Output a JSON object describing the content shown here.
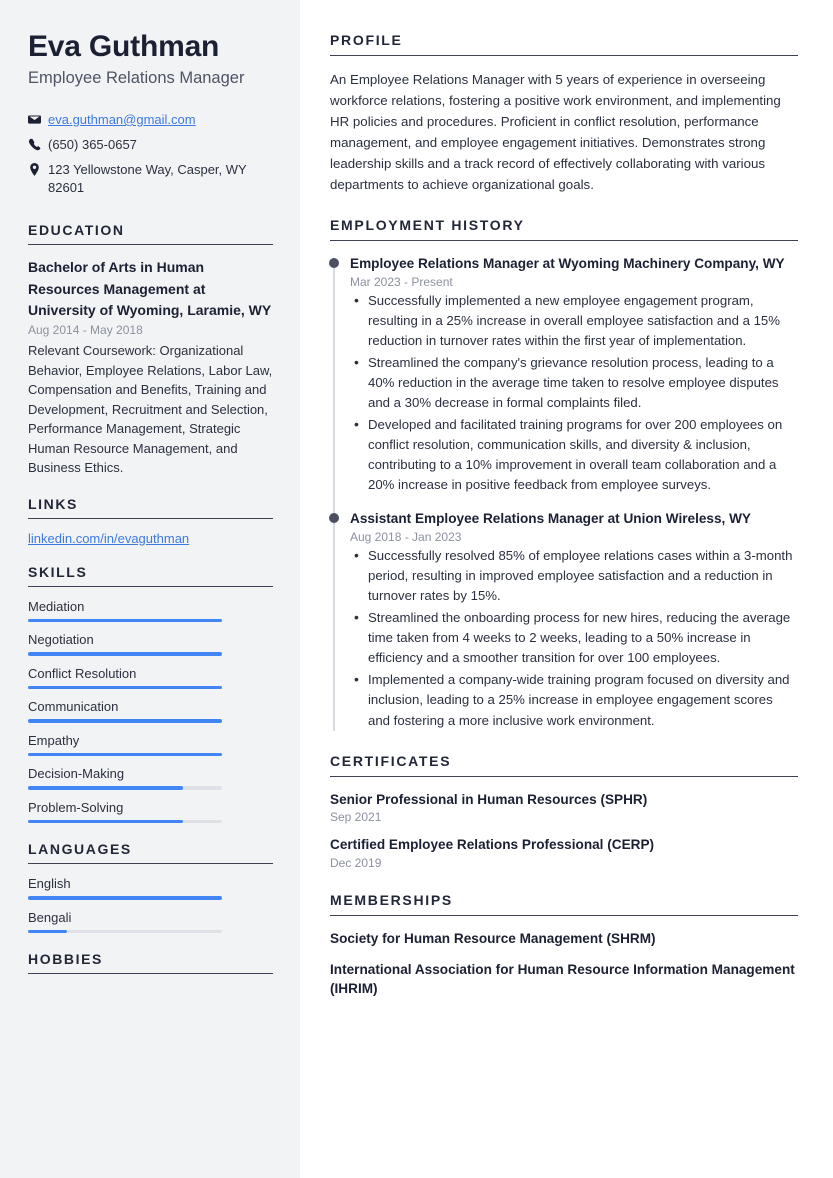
{
  "colors": {
    "accent": "#4285f4",
    "link": "#3d7ae0",
    "heading": "#222738",
    "sidebar_bg": "#f2f3f5",
    "muted": "#8c91a0",
    "dot": "#4a4f63"
  },
  "sidebar": {
    "name": "Eva Guthman",
    "job_title": "Employee Relations Manager",
    "contact": {
      "email": "eva.guthman@gmail.com",
      "phone": "(650) 365-0657",
      "address": "123 Yellowstone Way, Casper, WY 82601"
    },
    "education": {
      "heading": "EDUCATION",
      "items": [
        {
          "title": "Bachelor of Arts in Human Resources Management at University of Wyoming, Laramie, WY",
          "date": "Aug 2014 - May 2018",
          "description": "Relevant Coursework: Organizational Behavior, Employee Relations, Labor Law, Compensation and Benefits, Training and Development, Recruitment and Selection, Performance Management, Strategic Human Resource Management, and Business Ethics."
        }
      ]
    },
    "links": {
      "heading": "LINKS",
      "items": [
        {
          "label": "linkedin.com/in/evaguthman"
        }
      ]
    },
    "skills": {
      "heading": "SKILLS",
      "items": [
        {
          "label": "Mediation",
          "level": 100
        },
        {
          "label": "Negotiation",
          "level": 100
        },
        {
          "label": "Conflict Resolution",
          "level": 100
        },
        {
          "label": "Communication",
          "level": 100
        },
        {
          "label": "Empathy",
          "level": 100
        },
        {
          "label": "Decision-Making",
          "level": 80
        },
        {
          "label": "Problem-Solving",
          "level": 80
        }
      ]
    },
    "languages": {
      "heading": "LANGUAGES",
      "items": [
        {
          "label": "English",
          "level": 100
        },
        {
          "label": "Bengali",
          "level": 20
        }
      ]
    },
    "hobbies": {
      "heading": "HOBBIES"
    }
  },
  "main": {
    "profile": {
      "heading": "PROFILE",
      "text": "An Employee Relations Manager with 5 years of experience in overseeing workforce relations, fostering a positive work environment, and implementing HR policies and procedures. Proficient in conflict resolution, performance management, and employee engagement initiatives. Demonstrates strong leadership skills and a track record of effectively collaborating with various departments to achieve organizational goals."
    },
    "employment": {
      "heading": "EMPLOYMENT HISTORY",
      "jobs": [
        {
          "role": "Employee Relations Manager at Wyoming Machinery Company, WY",
          "date": "Mar 2023 - Present",
          "bullets": [
            "Successfully implemented a new employee engagement program, resulting in a 25% increase in overall employee satisfaction and a 15% reduction in turnover rates within the first year of implementation.",
            "Streamlined the company's grievance resolution process, leading to a 40% reduction in the average time taken to resolve employee disputes and a 30% decrease in formal complaints filed.",
            "Developed and facilitated training programs for over 200 employees on conflict resolution, communication skills, and diversity & inclusion, contributing to a 10% improvement in overall team collaboration and a 20% increase in positive feedback from employee surveys."
          ]
        },
        {
          "role": "Assistant Employee Relations Manager at Union Wireless, WY",
          "date": "Aug 2018 - Jan 2023",
          "bullets": [
            "Successfully resolved 85% of employee relations cases within a 3-month period, resulting in improved employee satisfaction and a reduction in turnover rates by 15%.",
            "Streamlined the onboarding process for new hires, reducing the average time taken from 4 weeks to 2 weeks, leading to a 50% increase in efficiency and a smoother transition for over 100 employees.",
            "Implemented a company-wide training program focused on diversity and inclusion, leading to a 25% increase in employee engagement scores and fostering a more inclusive work environment."
          ]
        }
      ]
    },
    "certificates": {
      "heading": "CERTIFICATES",
      "items": [
        {
          "title": "Senior Professional in Human Resources (SPHR)",
          "date": "Sep 2021"
        },
        {
          "title": "Certified Employee Relations Professional (CERP)",
          "date": "Dec 2019"
        }
      ]
    },
    "memberships": {
      "heading": "MEMBERSHIPS",
      "items": [
        {
          "title": "Society for Human Resource Management (SHRM)"
        },
        {
          "title": "International Association for Human Resource Information Management (IHRIM)"
        }
      ]
    }
  }
}
